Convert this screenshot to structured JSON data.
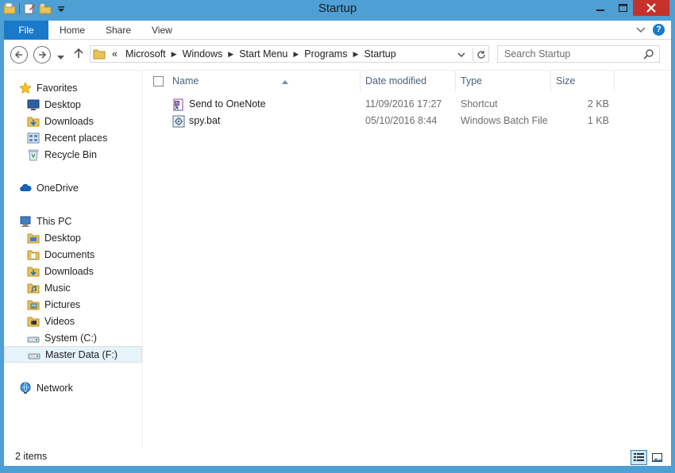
{
  "window": {
    "title": "Startup"
  },
  "ribbon": {
    "tabs": [
      {
        "label": "File"
      },
      {
        "label": "Home"
      },
      {
        "label": "Share"
      },
      {
        "label": "View"
      }
    ],
    "help": "?"
  },
  "address": {
    "overflow": "«",
    "crumbs": [
      "Microsoft",
      "Windows",
      "Start Menu",
      "Programs",
      "Startup"
    ]
  },
  "search": {
    "placeholder": "Search Startup"
  },
  "nav": {
    "favorites": {
      "label": "Favorites",
      "icon": "star-icon"
    },
    "favorite_items": [
      {
        "label": "Desktop",
        "icon": "desktop-icon"
      },
      {
        "label": "Downloads",
        "icon": "downloads-folder-icon"
      },
      {
        "label": "Recent places",
        "icon": "recent-places-icon"
      },
      {
        "label": "Recycle Bin",
        "icon": "recycle-bin-icon"
      }
    ],
    "onedrive": {
      "label": "OneDrive",
      "icon": "cloud-icon"
    },
    "thispc": {
      "label": "This PC",
      "icon": "computer-icon"
    },
    "pc_items": [
      {
        "label": "Desktop",
        "icon": "folder-icon"
      },
      {
        "label": "Documents",
        "icon": "folder-icon"
      },
      {
        "label": "Downloads",
        "icon": "downloads-folder-icon"
      },
      {
        "label": "Music",
        "icon": "music-folder-icon"
      },
      {
        "label": "Pictures",
        "icon": "pictures-folder-icon"
      },
      {
        "label": "Videos",
        "icon": "videos-folder-icon"
      },
      {
        "label": "System (C:)",
        "icon": "drive-icon"
      },
      {
        "label": "Master Data (F:)",
        "icon": "drive-icon",
        "selected": true
      }
    ],
    "network": {
      "label": "Network",
      "icon": "network-icon"
    }
  },
  "files": {
    "columns": {
      "name": "Name",
      "date": "Date modified",
      "type": "Type",
      "size": "Size"
    },
    "rows": [
      {
        "name": "Send to OneNote",
        "date": "11/09/2016 17:27",
        "type": "Shortcut",
        "size": "2 KB",
        "icon": "onenote-shortcut-icon"
      },
      {
        "name": "spy.bat",
        "date": "05/10/2016 8:44",
        "type": "Windows Batch File",
        "size": "1 KB",
        "icon": "batch-file-icon"
      }
    ]
  },
  "status": {
    "items": "2 items"
  },
  "colors": {
    "frame": "#4e9fd3",
    "file_tab": "#1979ca",
    "close_button": "#c7312b",
    "selection": "#e5f3fb",
    "header_text": "#4c607a"
  }
}
